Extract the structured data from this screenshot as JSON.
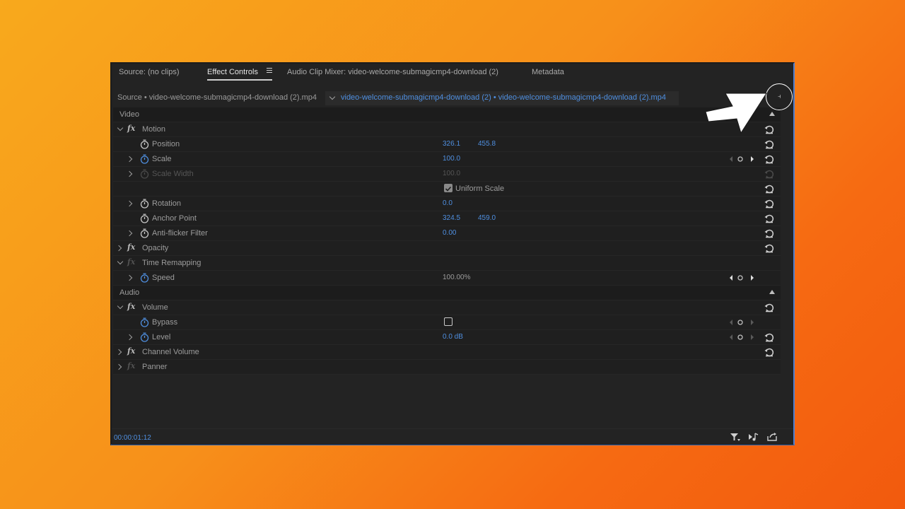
{
  "tabs": {
    "source": "Source: (no clips)",
    "effect_controls": "Effect Controls",
    "audio_mixer": "Audio Clip Mixer: video-welcome-submagicmp4-download (2)",
    "metadata": "Metadata"
  },
  "clip_bar": {
    "source_clip": "Source • video-welcome-submagicmp4-download (2).mp4",
    "sequence_clip": "video-welcome-submagicmp4-download (2) • video-welcome-submagicmp4-download (2).mp4"
  },
  "sections": {
    "video": "Video",
    "audio": "Audio"
  },
  "motion": {
    "label": "Motion",
    "position": {
      "label": "Position",
      "x": "326.1",
      "y": "455.8"
    },
    "scale": {
      "label": "Scale",
      "value": "100.0"
    },
    "scale_width": {
      "label": "Scale Width",
      "value": "100.0"
    },
    "uniform_scale": {
      "label": "Uniform Scale",
      "checked": true
    },
    "rotation": {
      "label": "Rotation",
      "value": "0.0"
    },
    "anchor_point": {
      "label": "Anchor Point",
      "x": "324.5",
      "y": "459.0"
    },
    "anti_flicker": {
      "label": "Anti-flicker Filter",
      "value": "0.00"
    }
  },
  "opacity": {
    "label": "Opacity"
  },
  "time_remapping": {
    "label": "Time Remapping",
    "speed": {
      "label": "Speed",
      "value": "100.00%"
    }
  },
  "volume": {
    "label": "Volume",
    "bypass": {
      "label": "Bypass",
      "checked": false
    },
    "level": {
      "label": "Level",
      "value": "0.0 dB"
    }
  },
  "channel_volume": {
    "label": "Channel Volume"
  },
  "panner": {
    "label": "Panner"
  },
  "footer": {
    "timecode": "00:00:01:12"
  },
  "colors": {
    "accent_blue": "#4f8fe0",
    "panel_bg": "#232323",
    "row_bg": "#1f1f1f"
  },
  "icons": [
    "stopwatch-icon",
    "reset-icon",
    "fx-icon",
    "filter-icon",
    "audio-loop-icon",
    "export-icon",
    "keyframe-nav-icon"
  ]
}
